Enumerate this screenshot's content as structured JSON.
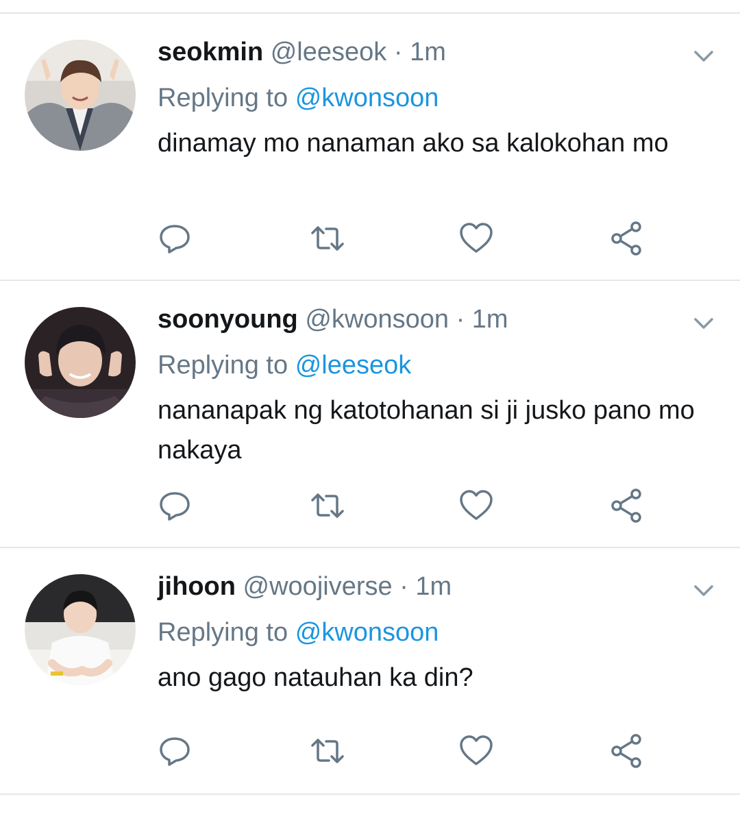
{
  "tweets": [
    {
      "name": "seokmin",
      "handle": "@leeseok",
      "separator": "·",
      "time": "1m",
      "replying_label": "Replying to",
      "replying_to": "@kwonsoon",
      "text": "dinamay mo nanaman ako sa kalokohan mo"
    },
    {
      "name": "soonyoung",
      "handle": "@kwonsoon",
      "separator": "·",
      "time": "1m",
      "replying_label": "Replying to",
      "replying_to": "@leeseok",
      "text": "nananapak ng katotohanan si ji jusko pano mo nakaya"
    },
    {
      "name": "jihoon",
      "handle": "@woojiverse",
      "separator": "·",
      "time": "1m",
      "replying_label": "Replying to",
      "replying_to": "@kwonsoon",
      "text": "ano gago natauhan ka din?"
    }
  ],
  "icons": {
    "reply": "reply-icon",
    "retweet": "retweet-icon",
    "like": "heart-icon",
    "share": "share-icon",
    "menu": "chevron-down-icon"
  },
  "colors": {
    "text": "#14171a",
    "secondary": "#657786",
    "mention": "#1b95e0",
    "divider": "#e3e7eb"
  }
}
